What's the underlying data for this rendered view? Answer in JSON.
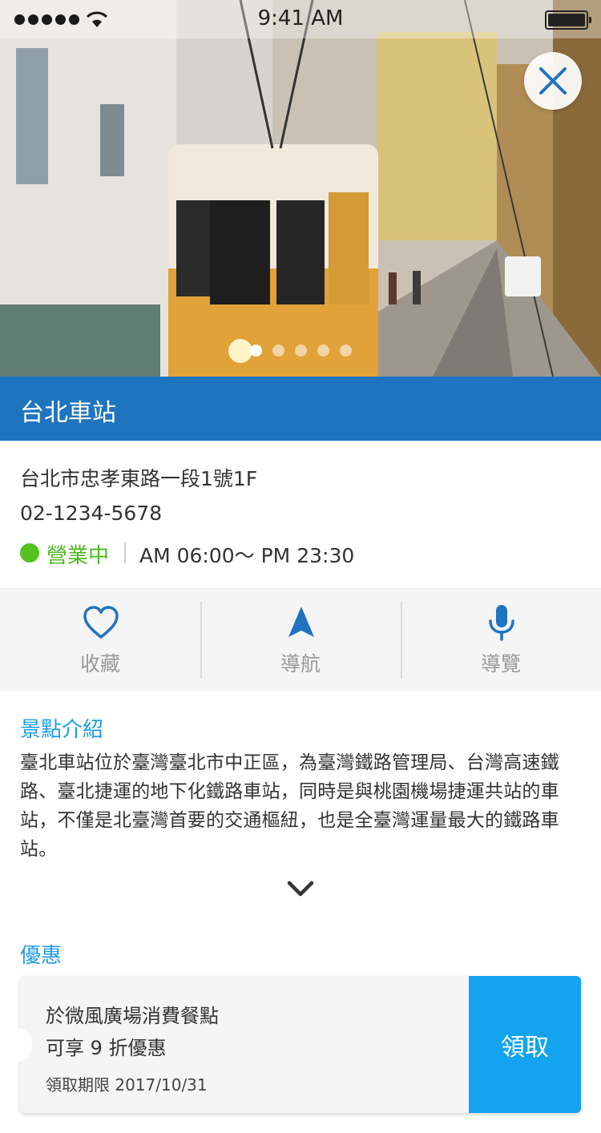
{
  "status_bar": {
    "time": "9:41 AM"
  },
  "hero": {
    "close_icon": "close-icon",
    "carousel": {
      "count": 5,
      "active": 1
    }
  },
  "place": {
    "name": "台北車站",
    "address": "台北市忠孝東路一段1號1F",
    "phone": "02-1234-5678",
    "status": "營業中",
    "hours": "AM 06:00～ PM 23:30"
  },
  "actions": [
    {
      "label": "收藏",
      "icon": "heart-icon"
    },
    {
      "label": "導航",
      "icon": "navigation-arrow-icon"
    },
    {
      "label": "導覽",
      "icon": "microphone-icon"
    }
  ],
  "intro": {
    "heading": "景點介紹",
    "text": "臺北車站位於臺灣臺北市中正區，為臺灣鐵路管理局、台灣高速鐵路、臺北捷運的地下化鐵路車站，同時是與桃園機場捷運共站的車站，不僅是北臺灣首要的交通樞紐，也是全臺灣運量最大的鐵路車站。",
    "expand_icon": "chevron-down-icon"
  },
  "offer": {
    "heading": "優惠",
    "line1": "於微風廣場消費餐點",
    "line2": "可享 9 折優惠",
    "deadline": "領取期限 2017/10/31",
    "claim_label": "領取"
  },
  "colors": {
    "primary": "#1f74c0",
    "accent": "#1e9be6",
    "open": "#54c21f",
    "claim": "#13a3ef"
  }
}
